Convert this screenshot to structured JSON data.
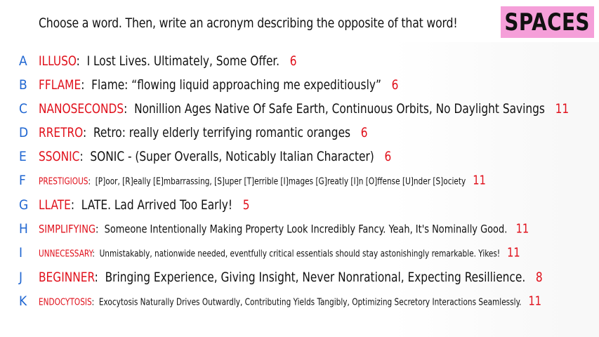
{
  "instruction": "Choose a word. Then, write an acronym describing the opposite of that word!",
  "logo": {
    "text": "SPACES",
    "bg": "#f59fd9"
  },
  "colors": {
    "letter": "#1f66d1",
    "word": "#e0101b",
    "score": "#e0101b",
    "text": "#111111"
  },
  "rows": [
    {
      "letter": "A",
      "word": "ILLUSO",
      "acronym": "I Lost Lives. Ultimately, Some Offer.",
      "score": "6"
    },
    {
      "letter": "B",
      "word": "FFLAME",
      "acronym": "Flame: “flowing liquid approaching me expeditiously”",
      "score": "6"
    },
    {
      "letter": "C",
      "word": "NANOSECONDS",
      "acronym": "Nonillion Ages Native Of Safe Earth, Continuous Orbits, No Daylight Savings",
      "score": "11"
    },
    {
      "letter": "D",
      "word": "RRETRO",
      "acronym": "Retro: really elderly terrifying romantic oranges",
      "score": "6"
    },
    {
      "letter": "E",
      "word": "SSONIC",
      "acronym": "SONIC - (Super Overalls, Noticably Italian Character)",
      "score": "6"
    },
    {
      "letter": "F",
      "word": "PRESTIGIOUS",
      "acronym": "[P]oor, [R]eally [E]mbarrassing, [S]uper [T]errible [I]mages [G]reatly [I]n [O]ffense [U]nder [S]ociety",
      "score": "11"
    },
    {
      "letter": "G",
      "word": "LLATE",
      "acronym": "LATE. Lad Arrived Too Early!",
      "score": "5"
    },
    {
      "letter": "H",
      "word": "SIMPLIFYING",
      "acronym": "Someone Intentionally Making Property Look Incredibly Fancy. Yeah, It's Nominally Good.",
      "score": "11"
    },
    {
      "letter": "I",
      "word": "UNNECESSARY",
      "acronym": "Unmistakably, nationwide needed, eventfully critical essentials should stay astonishingly remarkable. Yikes!",
      "score": "11"
    },
    {
      "letter": "J",
      "word": "BEGINNER",
      "acronym": "Bringing Experience, Giving Insight, Never Nonrational, Expecting Resillience.",
      "score": "8"
    },
    {
      "letter": "K",
      "word": "ENDOCYTOSIS",
      "acronym": "Exocytosis Naturally Drives Outwardly, Contributing Yields Tangibly, Optimizing Secretory Interactions Seamlessly.",
      "score": "11"
    }
  ]
}
